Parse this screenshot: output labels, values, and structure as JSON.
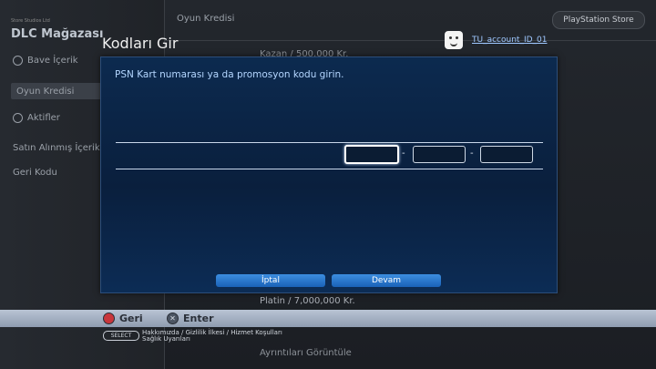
{
  "background": {
    "sidebar": {
      "small_text": "Store Studios Ltd",
      "title": "DLC Mağazası",
      "items": [
        {
          "label": "Bave İçerik",
          "icon": "ps-icon"
        },
        {
          "label": "Oyun Kredisi",
          "icon": ""
        },
        {
          "label": "Aktifler",
          "icon": "gear-icon"
        },
        {
          "label": "Satın Alınmış İçerik",
          "icon": ""
        },
        {
          "label": "Geri Kodu",
          "icon": ""
        }
      ]
    },
    "page_title": "Oyun Kredisi",
    "store_button": "PlayStation Store",
    "lines": [
      "Kazan / 500,000 Kr.",
      "Platin / 7,000,000 Kr.",
      "Ayrıntıları Görüntüle"
    ]
  },
  "dialog": {
    "title": "Kodları Gir",
    "account": "TU_account_ID_01",
    "prompt": "PSN Kart numarası ya da promosyon kodu girin.",
    "code_fields": [
      "",
      "",
      ""
    ],
    "separator": "-",
    "cancel_label": "İptal",
    "continue_label": "Devam"
  },
  "hints": {
    "back_label": "Geri",
    "enter_label": "Enter",
    "select_label": "SELECT",
    "legal_line1": "Hakkımızda / Gizlilik İlkesi / Hizmet Koşulları",
    "legal_line2": "Sağlık Uyarıları"
  }
}
